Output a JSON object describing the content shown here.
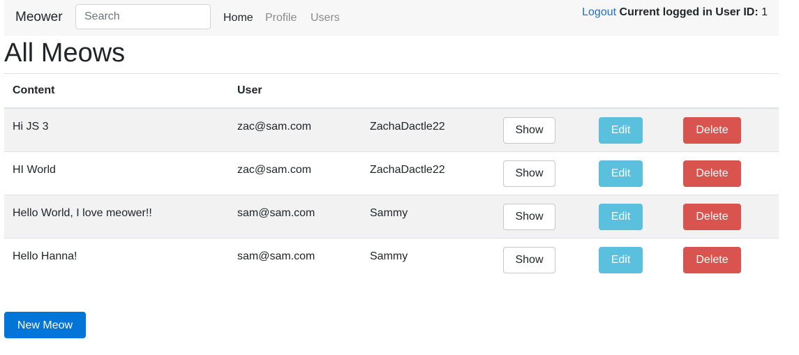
{
  "navbar": {
    "brand": "Meower",
    "search_placeholder": "Search",
    "search_value": "",
    "links": {
      "home": "Home",
      "profile": "Profile",
      "users": "Users"
    },
    "logout": "Logout",
    "status_label": "Current logged in User ID:",
    "user_id": "1"
  },
  "page": {
    "title": "All Meows"
  },
  "table": {
    "headers": {
      "content": "Content",
      "user": "User"
    },
    "rows": [
      {
        "content": "Hi JS 3",
        "email": "zac@sam.com",
        "username": "ZachaDactle22",
        "show": "Show",
        "edit": "Edit",
        "delete": "Delete"
      },
      {
        "content": "HI World",
        "email": "zac@sam.com",
        "username": "ZachaDactle22",
        "show": "Show",
        "edit": "Edit",
        "delete": "Delete"
      },
      {
        "content": "Hello World, I love meower!!",
        "email": "sam@sam.com",
        "username": "Sammy",
        "show": "Show",
        "edit": "Edit",
        "delete": "Delete"
      },
      {
        "content": "Hello Hanna!",
        "email": "sam@sam.com",
        "username": "Sammy",
        "show": "Show",
        "edit": "Edit",
        "delete": "Delete"
      }
    ]
  },
  "actions": {
    "new_meow": "New Meow"
  },
  "colors": {
    "navbar_bg": "#f7f7f7",
    "link": "#1a6fc7",
    "primary": "#0275d8",
    "info": "#5bc0de",
    "danger": "#d9534f",
    "striped_row": "#f2f2f2"
  }
}
